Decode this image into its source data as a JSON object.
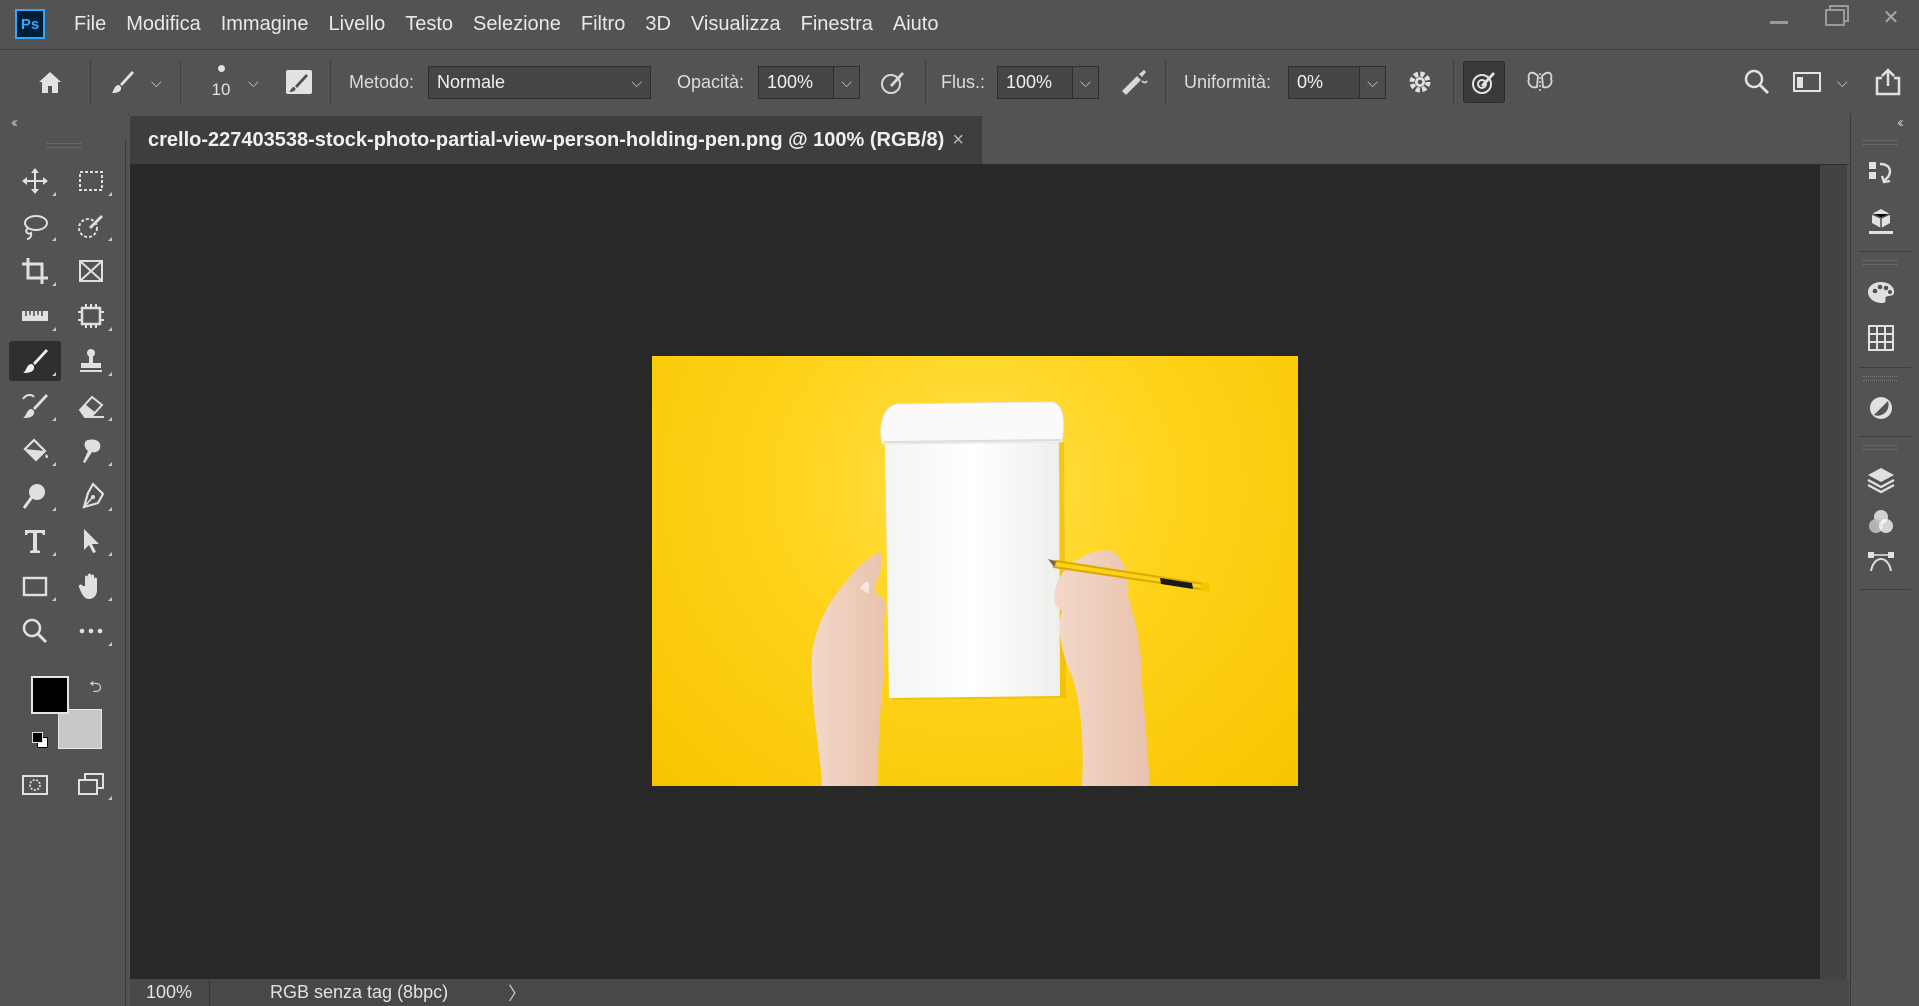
{
  "app": {
    "logo_text": "Ps"
  },
  "menu": [
    "File",
    "Modifica",
    "Immagine",
    "Livello",
    "Testo",
    "Selezione",
    "Filtro",
    "3D",
    "Visualizza",
    "Finestra",
    "Aiuto"
  ],
  "window_controls": {
    "close": "✕"
  },
  "options_bar": {
    "brush_size": "10",
    "mode_label": "Metodo:",
    "mode_value": "Normale",
    "opacity_label": "Opacità:",
    "opacity_value": "100%",
    "flow_label": "Flus.:",
    "flow_value": "100%",
    "smoothing_label": "Uniformità:",
    "smoothing_value": "0%"
  },
  "document": {
    "tab_title": "crello-227403538-stock-photo-partial-view-person-holding-pen.png @ 100% (RGB/8)",
    "tab_close": "×"
  },
  "status": {
    "zoom": "100%",
    "info": "RGB senza tag (8bpc)",
    "more": "〉"
  },
  "colors": {
    "foreground": "#000000",
    "background": "#c8c8c8",
    "photo_background": "#ffd31a"
  },
  "tools": [
    "move-tool-icon",
    "rectangular-marquee-icon",
    "lasso-icon",
    "quick-selection-icon",
    "crop-icon",
    "frame-icon",
    "ruler-icon",
    "content-aware-icon",
    "brush-icon",
    "clone-stamp-icon",
    "history-brush-icon",
    "eraser-icon",
    "paint-bucket-icon",
    "smudge-icon",
    "dodge-icon",
    "pen-icon",
    "type-icon",
    "path-selection-icon",
    "rectangle-icon",
    "hand-icon",
    "zoom-icon",
    "more-tools-icon",
    "quick-mask-icon",
    "screen-mode-icon"
  ],
  "right_panels": [
    "history-panel-icon",
    "3d-panel-icon",
    "color-panel-icon",
    "swatches-panel-icon",
    "adjustments-panel-icon",
    "layers-panel-icon",
    "channels-panel-icon",
    "paths-panel-icon"
  ]
}
